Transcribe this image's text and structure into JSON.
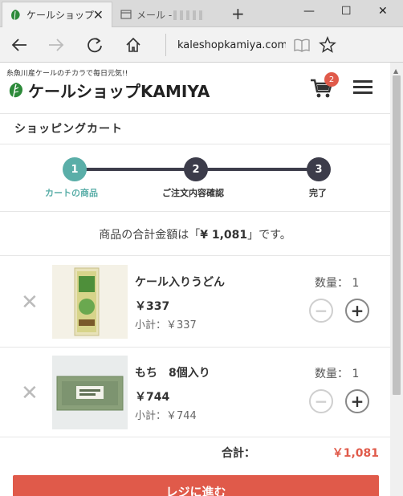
{
  "browser": {
    "tabs": [
      {
        "title": "ケールショップK.",
        "active": true
      },
      {
        "title": "メール -",
        "active": false
      }
    ],
    "url": "kaleshopkamiya.com/c",
    "new_tab_symbol": "+",
    "window_controls": {
      "minimize": "—",
      "maximize": "☐",
      "close": "✕"
    }
  },
  "header": {
    "tagline": "糸魚川産ケールのチカラで毎日元気!!",
    "logo_text": "ケールショップKAMIYA",
    "cart_count": "2",
    "logo_color": "#2d8a3a"
  },
  "page_title": "ショッピングカート",
  "steps": [
    {
      "number": "1",
      "label": "カートの商品",
      "state": "active"
    },
    {
      "number": "2",
      "label": "ご注文内容確認",
      "state": "todo"
    },
    {
      "number": "3",
      "label": "完了",
      "state": "todo"
    }
  ],
  "total_message": {
    "prefix": "商品の合計金額は「",
    "amount": "¥ 1,081",
    "suffix": "」です。"
  },
  "items": [
    {
      "name": "ケール入りうどん",
      "price": "￥337",
      "subtotal": "小計：￥337",
      "quantity_label": "数量：",
      "quantity": "1"
    },
    {
      "name": "もち　8個入り",
      "price": "￥744",
      "subtotal": "小計：￥744",
      "quantity_label": "数量：",
      "quantity": "1"
    }
  ],
  "summary": {
    "label": "合計：",
    "value": "￥1,081"
  },
  "checkout_button": "レジに進む",
  "colors": {
    "accent_teal": "#5aaea8",
    "step_dark": "#3c3c4a",
    "accent_red": "#e05a4a"
  }
}
